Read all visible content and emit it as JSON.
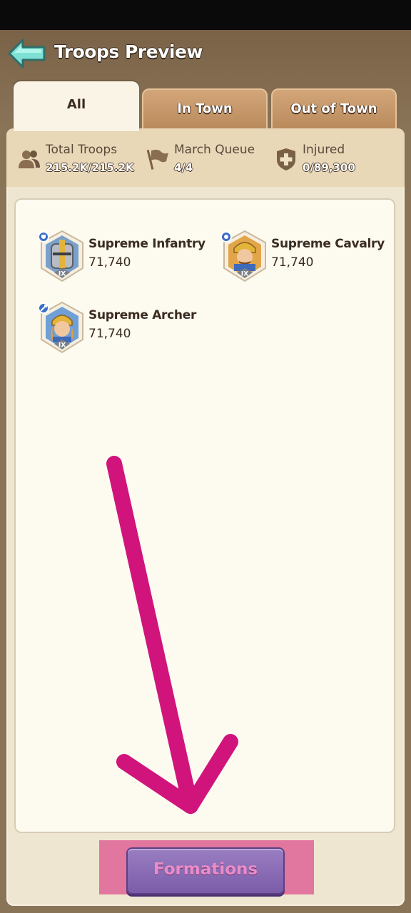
{
  "header": {
    "title": "Troops Preview"
  },
  "tabs": [
    {
      "label": "All",
      "active": true
    },
    {
      "label": "In Town",
      "active": false
    },
    {
      "label": "Out of Town",
      "active": false
    }
  ],
  "stats": {
    "total": {
      "label": "Total Troops",
      "value": "215.2K/215.2K",
      "icon": "users-icon"
    },
    "march": {
      "label": "March Queue",
      "value": "4/4",
      "icon": "flag-icon"
    },
    "injured": {
      "label": "Injured",
      "value": "0/89,300",
      "icon": "injured-cross-icon"
    }
  },
  "troops": [
    {
      "name": "Supreme Infantry",
      "count": "71,740",
      "tier": "IX"
    },
    {
      "name": "Supreme Cavalry",
      "count": "71,740",
      "tier": "IX"
    },
    {
      "name": "Supreme Archer",
      "count": "71,740",
      "tier": "IX"
    }
  ],
  "footer": {
    "formations_label": "Formations"
  },
  "colors": {
    "arrow": "#d0147c",
    "highlight": "#dc508c",
    "button": "#8a6cb6"
  }
}
